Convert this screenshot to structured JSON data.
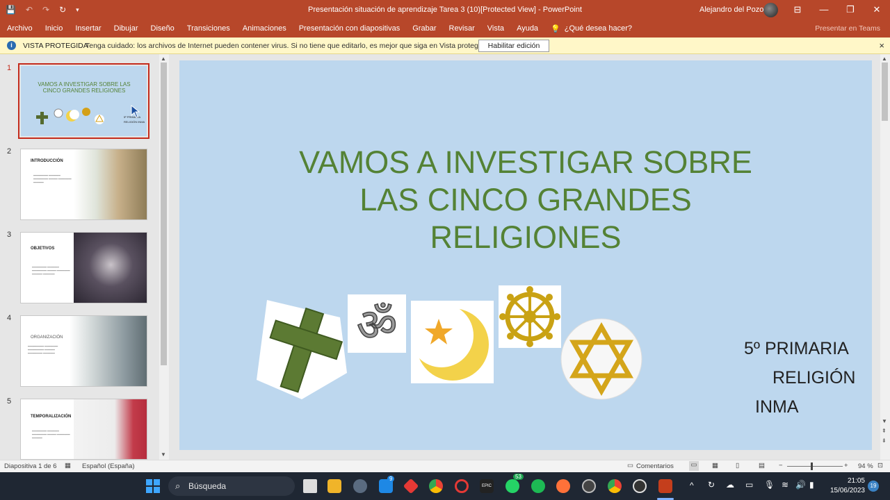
{
  "window": {
    "title": "Presentación situación de aprendizaje Tarea 3 (10)[Protected View] - PowerPoint",
    "user": "Alejandro del Pozo",
    "controls": {
      "minimize": "—",
      "restore": "❐",
      "close": "✕",
      "ribbon_opt": "⊟"
    }
  },
  "qat": {
    "save": "💾",
    "undo": "↶",
    "redo": "↷",
    "refresh": "↻",
    "customize": "▾"
  },
  "ribbon": {
    "tabs": [
      "Archivo",
      "Inicio",
      "Insertar",
      "Dibujar",
      "Diseño",
      "Transiciones",
      "Animaciones",
      "Presentación con diapositivas",
      "Grabar",
      "Revisar",
      "Vista",
      "Ayuda"
    ],
    "tell_me": "¿Qué desea hacer?",
    "present_teams": "Presentar en Teams"
  },
  "protected_view": {
    "label": "VISTA PROTEGIDA",
    "message": "Tenga cuidado: los archivos de Internet pueden contener virus. Si no tiene que editarlo, es mejor que siga en Vista protegida.",
    "button": "Habilitar edición",
    "close": "×"
  },
  "thumbnails": [
    {
      "num": "1",
      "title": "VAMOS A INVESTIGAR SOBRE LAS CINCO GRANDES RELIGIONES",
      "sub": "5º PRIMARIA RELIGIÓN INMA"
    },
    {
      "num": "2",
      "title": "INTRODUCCIÓN"
    },
    {
      "num": "3",
      "title": "OBJETIVOS"
    },
    {
      "num": "4",
      "title": "ORGANIZACIÓN"
    },
    {
      "num": "5",
      "title": "TEMPORALIZACIÓN"
    }
  ],
  "slide": {
    "title_lines": [
      "VAMOS A INVESTIGAR SOBRE",
      "LAS CINCO GRANDES",
      "RELIGIONES"
    ],
    "subtitle": {
      "line1": "5º PRIMARIA",
      "line2": "RELIGIÓN",
      "line3": "INMA"
    },
    "symbols": [
      "cross-icon",
      "om-icon",
      "crescent-star-icon",
      "dharma-wheel-icon",
      "star-of-david-icon"
    ]
  },
  "status": {
    "slide_counter": "Diapositiva 1 de 6",
    "language": "Español (España)",
    "comments": "Comentarios",
    "zoom": "94 %"
  },
  "taskbar": {
    "search": "Búsqueda",
    "time": "21:05",
    "date": "15/06/2023",
    "badge_whatsapp": "53",
    "badge_store": "9",
    "notif": "19"
  },
  "colors": {
    "accent": "#b7472a",
    "slide_bg": "#bdd7ee",
    "title_green": "#548235"
  }
}
